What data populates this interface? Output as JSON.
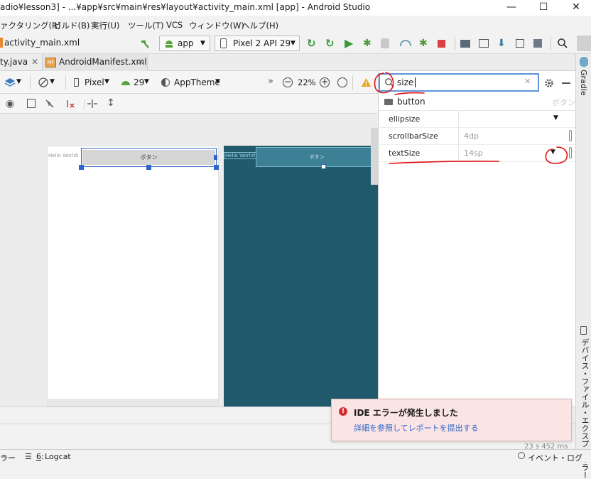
{
  "window": {
    "title": "adio¥lesson3] - ...¥app¥src¥main¥res¥layout¥activity_main.xml [app] - Android Studio",
    "minimize": "—",
    "maximize": "☐",
    "close": "✕"
  },
  "menu": {
    "items": [
      "ァクタリング(R)",
      "ビルド(B)",
      "実行(U)",
      "ツール(T)",
      "VCS",
      "ウィンドウ(W)",
      "ヘルプ(H)"
    ]
  },
  "toolbar": {
    "breadcrumb": "activity_main.xml",
    "run_config": "app",
    "device": "Pixel 2 API 29"
  },
  "tabs": [
    {
      "label": "ty.java"
    },
    {
      "label": "AndroidManifest.xml",
      "badge": "MF"
    }
  ],
  "design_toolbar": {
    "device": "Pixel",
    "api": "29",
    "theme": "AppTheme",
    "more": "»",
    "zoom": "22%"
  },
  "canvas": {
    "design": {
      "hello": "Hello World!",
      "button": "ボタン"
    },
    "blueprint": {
      "hello": "Hello World!",
      "button": "ボタン"
    }
  },
  "attributes": {
    "search_value": "size",
    "component": "button",
    "component_hint": "ボタン",
    "rows": [
      {
        "name": "ellipsize",
        "value": ""
      },
      {
        "name": "scrollbarSize",
        "value": "4dp"
      },
      {
        "name": "textSize",
        "value": "14sp"
      }
    ]
  },
  "right_strip": {
    "gradle": "Gradle",
    "device_explorer": "デバイス・ファイル・エクスプローラー"
  },
  "notification": {
    "title": "IDE エラーが発生しました",
    "link": "詳細を参照してレポートを提出する",
    "error_color": "#d32f2f"
  },
  "status": {
    "left": "ラー",
    "logcat_num": "6",
    "logcat": "Logcat",
    "timing": "23 s 452 ms",
    "event_log": "イベント・ログ"
  },
  "colors": {
    "accent": "#2f65ca",
    "blueprint_bg": "#215a6d",
    "annotation": "#e01010"
  }
}
